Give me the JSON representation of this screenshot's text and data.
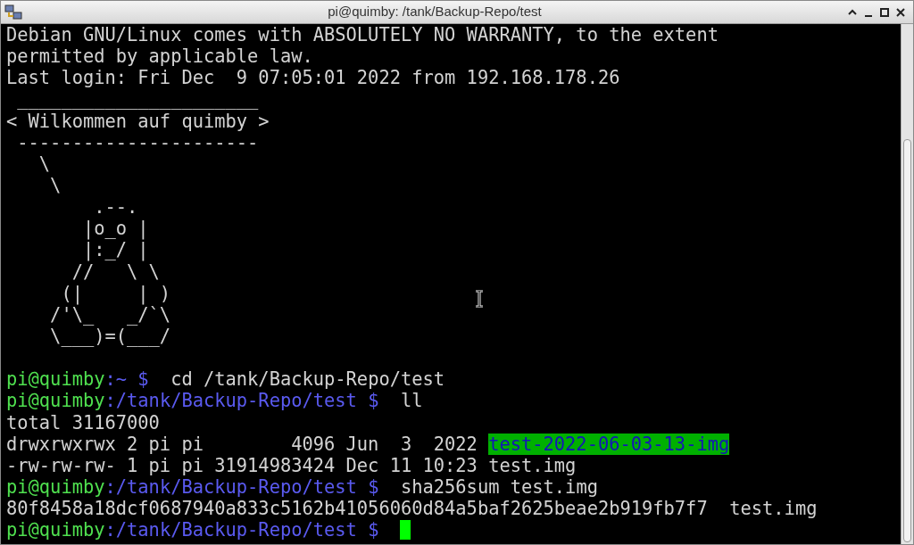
{
  "window": {
    "title": "pi@quimby: /tank/Backup-Repo/test"
  },
  "terminal": {
    "lines": [
      [
        {
          "kind": "text",
          "text": "Debian GNU/Linux comes with ABSOLUTELY NO WARRANTY, to the extent"
        }
      ],
      [
        {
          "kind": "text",
          "text": "permitted by applicable law."
        }
      ],
      [
        {
          "kind": "text",
          "text": "Last login: Fri Dec  9 07:05:01 2022 from 192.168.178.26"
        }
      ],
      [
        {
          "kind": "text",
          "text": " ______________________"
        }
      ],
      [
        {
          "kind": "text",
          "text": "< Wilkommen auf quimby >"
        }
      ],
      [
        {
          "kind": "text",
          "text": " ----------------------"
        }
      ],
      [
        {
          "kind": "text",
          "text": "   \\"
        }
      ],
      [
        {
          "kind": "text",
          "text": "    \\"
        }
      ],
      [
        {
          "kind": "text",
          "text": "        .--."
        }
      ],
      [
        {
          "kind": "text",
          "text": "       |o_o |"
        }
      ],
      [
        {
          "kind": "text",
          "text": "       |:_/ |"
        }
      ],
      [
        {
          "kind": "text",
          "text": "      //   \\ \\"
        }
      ],
      [
        {
          "kind": "text",
          "text": "     (|     | )"
        }
      ],
      [
        {
          "kind": "text",
          "text": "    /'\\_   _/`\\"
        }
      ],
      [
        {
          "kind": "text",
          "text": "    \\___)=(___/"
        }
      ],
      [
        {
          "kind": "blank"
        }
      ],
      [
        {
          "kind": "user",
          "text": "pi@quimby"
        },
        {
          "kind": "path",
          "text": ":~ $"
        },
        {
          "kind": "text",
          "text": "  cd /tank/Backup-Repo/test"
        }
      ],
      [
        {
          "kind": "user",
          "text": "pi@quimby"
        },
        {
          "kind": "path",
          "text": ":/tank/Backup-Repo/test $"
        },
        {
          "kind": "text",
          "text": "  ll"
        }
      ],
      [
        {
          "kind": "text",
          "text": "total 31167000"
        }
      ],
      [
        {
          "kind": "text",
          "text": "drwxrwxrwx 2 pi pi        4096 Jun  3  2022 "
        },
        {
          "kind": "highlight",
          "text": "test-2022-06-03-13-img"
        }
      ],
      [
        {
          "kind": "text",
          "text": "-rw-rw-rw- 1 pi pi 31914983424 Dec 11 10:23 test.img"
        }
      ],
      [
        {
          "kind": "user",
          "text": "pi@quimby"
        },
        {
          "kind": "path",
          "text": ":/tank/Backup-Repo/test $"
        },
        {
          "kind": "text",
          "text": "  sha256sum test.img"
        }
      ],
      [
        {
          "kind": "text",
          "text": "80f8458a18dcf0687940a833c5162b41056060d84a5baf2625beae2b919fb7f7  test.img"
        }
      ],
      [
        {
          "kind": "user",
          "text": "pi@quimby"
        },
        {
          "kind": "path",
          "text": ":/tank/Backup-Repo/test $"
        }
      ]
    ],
    "cursor": {
      "visible": true
    }
  }
}
